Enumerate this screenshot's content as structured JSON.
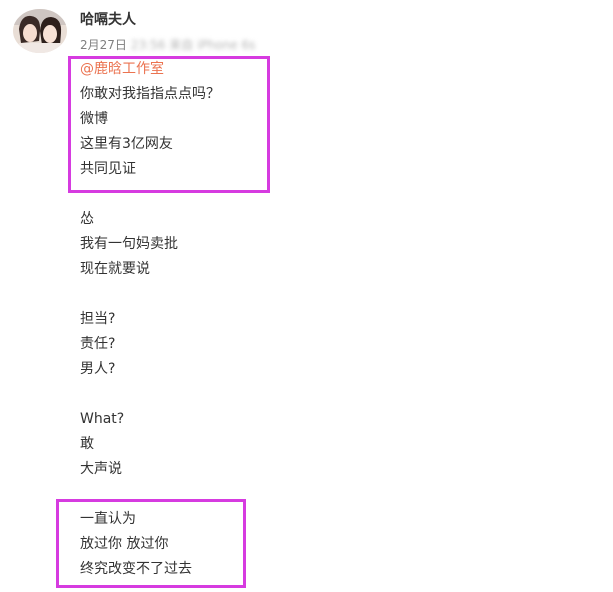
{
  "post": {
    "username": "哈嗝夫人",
    "date": "2月27日",
    "blurred_source": "23:56 来自 iPhone 6s",
    "mention": "@鹿晗工作室",
    "lines": [
      "你敢对我指指点点吗？",
      "微博",
      "这里有3亿网友",
      "共同见证",
      "",
      "怂",
      "我有一句妈卖批",
      "现在就要说",
      "",
      "担当?",
      "责任?",
      "男人?",
      "",
      "What?",
      "敢",
      "大声说",
      "",
      "一直认为",
      "放过你 放过你",
      "终究改变不了过去"
    ]
  },
  "colors": {
    "mention": "#eb7350",
    "highlight_box": "#d63be0"
  }
}
